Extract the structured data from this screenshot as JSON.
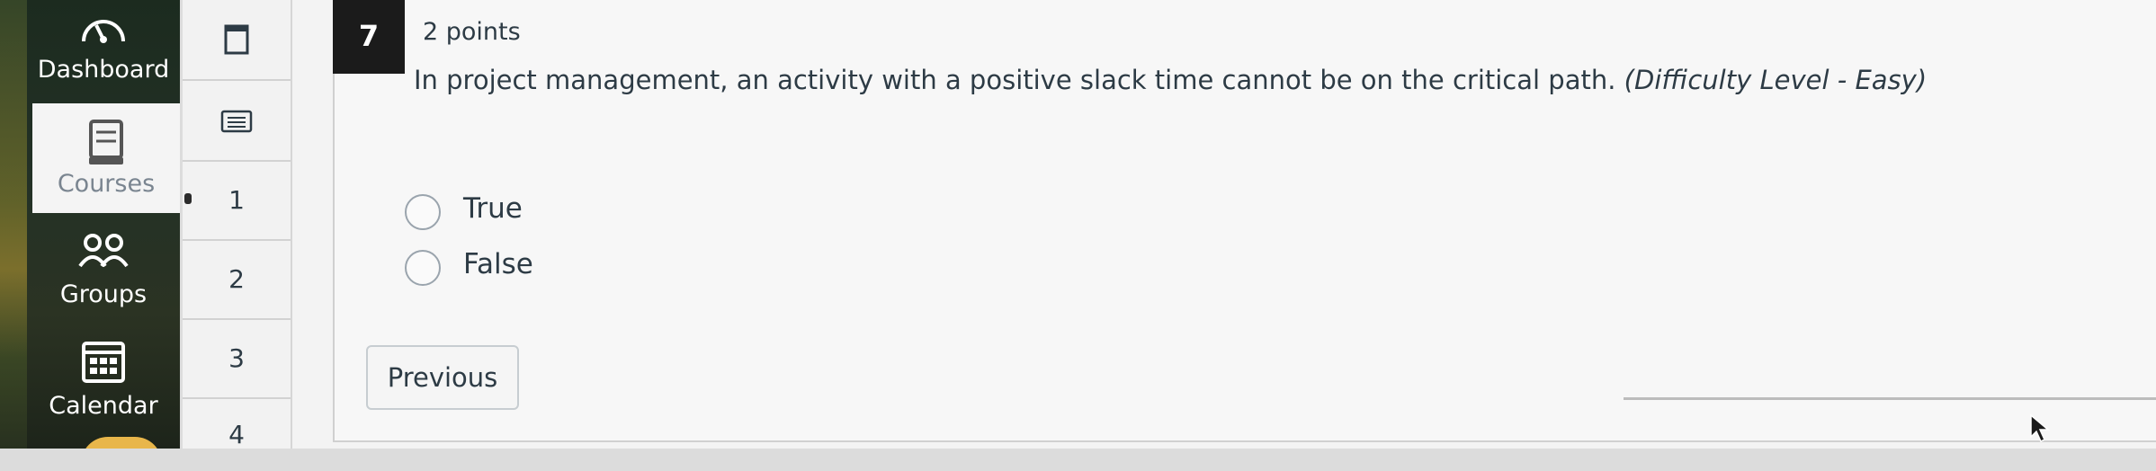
{
  "global_nav": {
    "items": [
      {
        "label": "Dashboard",
        "icon": "dashboard-gauge-icon"
      },
      {
        "label": "Courses",
        "icon": "courses-book-icon",
        "active": true
      },
      {
        "label": "Groups",
        "icon": "groups-people-icon"
      },
      {
        "label": "Calendar",
        "icon": "calendar-icon"
      }
    ]
  },
  "question_nav": {
    "items": [
      "1",
      "2",
      "3",
      "4"
    ]
  },
  "question": {
    "number": "7",
    "points": "2 points",
    "text": "In project management, an activity with a positive slack time cannot be on the critical path.",
    "difficulty": "(Difficulty Level - Easy)",
    "answers": [
      "True",
      "False"
    ]
  },
  "buttons": {
    "previous": "Previous"
  },
  "colors": {
    "text": "#2d3b45",
    "question_number_bg": "#1b1b1b",
    "nav_bg": "#1f2d22"
  }
}
